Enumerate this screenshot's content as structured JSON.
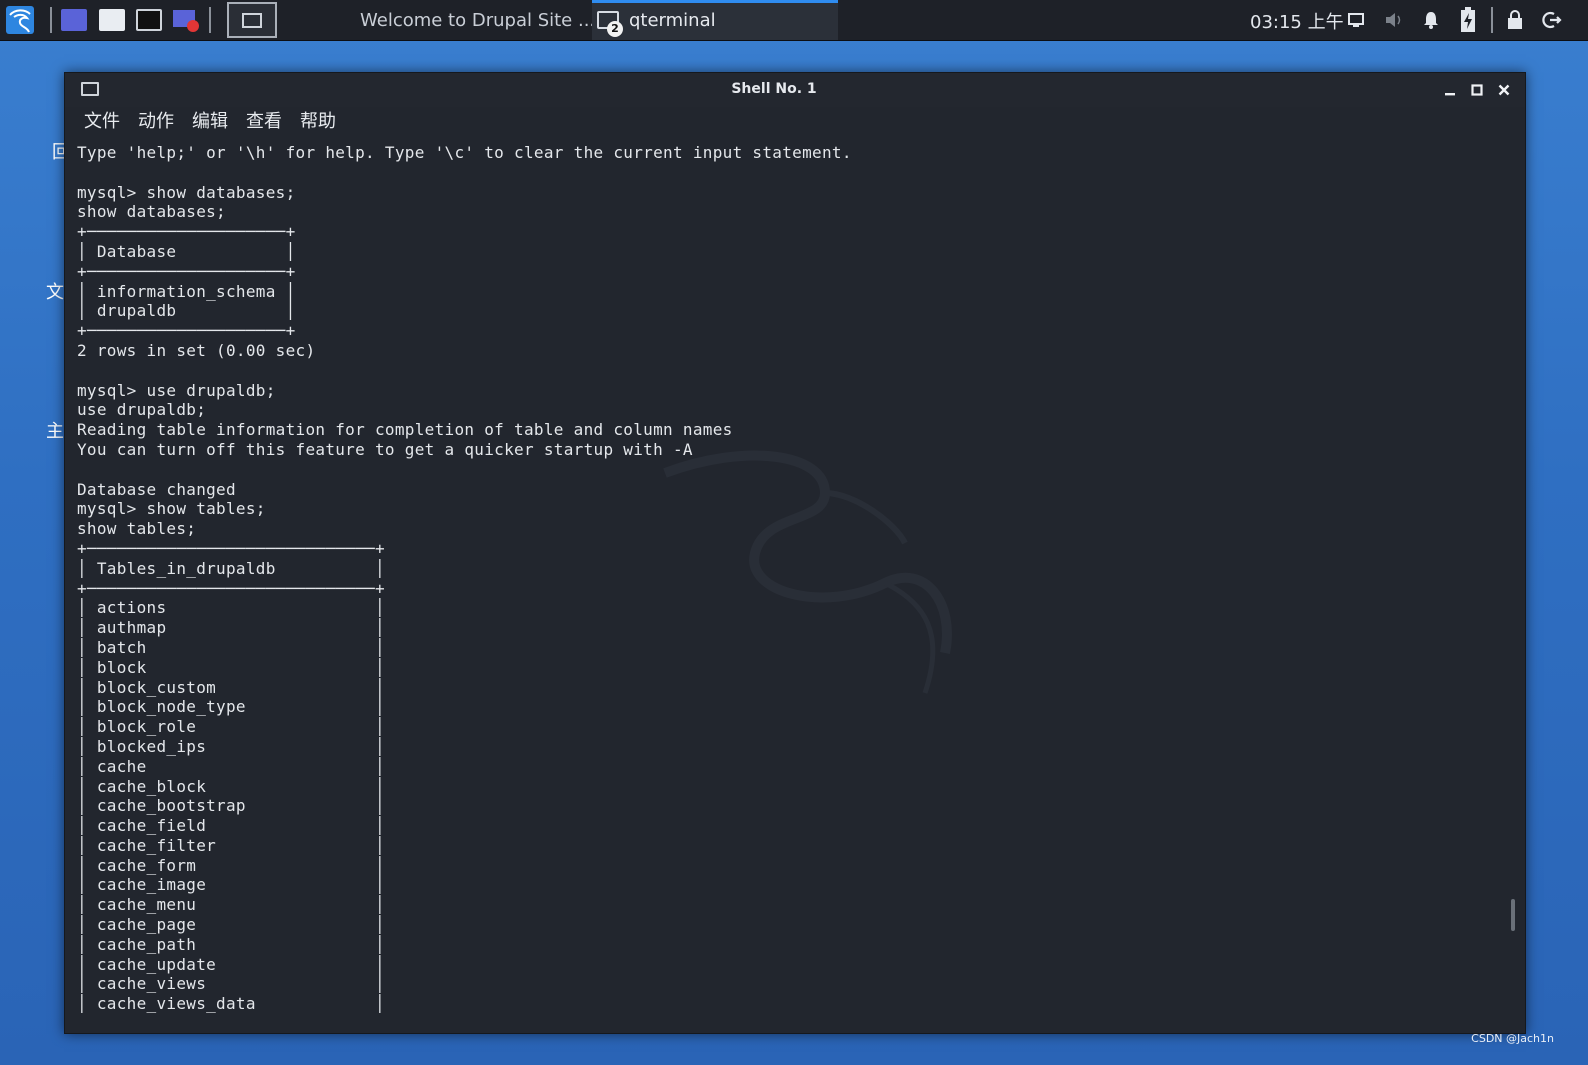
{
  "taskbar": {
    "tasks": [
      {
        "label": "Welcome to Drupal Site ...",
        "icon": "firefox-icon"
      },
      {
        "label": "qterminal",
        "icon": "terminal-icon",
        "badge": "2",
        "active": true
      }
    ],
    "clock": "03:15 上午",
    "accent_color": "#2f8cf0"
  },
  "window": {
    "title": "Shell No. 1",
    "menu": [
      "文件",
      "动作",
      "编辑",
      "查看",
      "帮助"
    ]
  },
  "terminal": {
    "lines": [
      "Type 'help;' or '\\h' for help. Type '\\c' to clear the current input statement.",
      "",
      "mysql> show databases;",
      "show databases;",
      "+────────────────────+",
      "│ Database           │",
      "+────────────────────+",
      "│ information_schema │",
      "│ drupaldb           │",
      "+────────────────────+",
      "2 rows in set (0.00 sec)",
      "",
      "mysql> use drupaldb;",
      "use drupaldb;",
      "Reading table information for completion of table and column names",
      "You can turn off this feature to get a quicker startup with -A",
      "",
      "Database changed",
      "mysql> show tables;",
      "show tables;",
      "+─────────────────────────────+",
      "│ Tables_in_drupaldb          │",
      "+─────────────────────────────+",
      "│ actions                     │",
      "│ authmap                     │",
      "│ batch                       │",
      "│ block                       │",
      "│ block_custom                │",
      "│ block_node_type             │",
      "│ block_role                  │",
      "│ blocked_ips                 │",
      "│ cache                       │",
      "│ cache_block                 │",
      "│ cache_bootstrap             │",
      "│ cache_field                 │",
      "│ cache_filter                │",
      "│ cache_form                  │",
      "│ cache_image                 │",
      "│ cache_menu                  │",
      "│ cache_page                  │",
      "│ cache_path                  │",
      "│ cache_update                │",
      "│ cache_views                 │",
      "│ cache_views_data            │"
    ]
  },
  "desktop": {
    "glyphs": [
      "回",
      "文",
      "主"
    ]
  },
  "watermark": "CSDN @Jach1n"
}
